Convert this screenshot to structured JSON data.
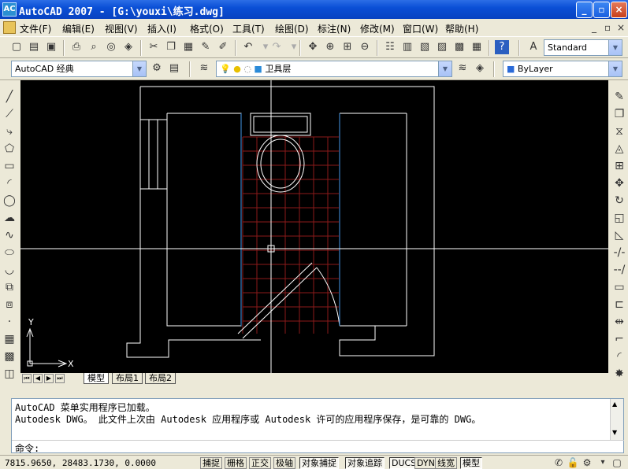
{
  "window": {
    "icon_text": "AC",
    "title": "AutoCAD 2007 - [G:\\youxi\\练习.dwg]",
    "minimize": "_",
    "maximize": "▫",
    "close": "×"
  },
  "menu": {
    "items": [
      "文件(F)",
      "编辑(E)",
      "视图(V)",
      "插入(I)",
      "格式(O)",
      "工具(T)",
      "绘图(D)",
      "标注(N)",
      "修改(M)",
      "窗口(W)",
      "帮助(H)"
    ],
    "mdi_min": "_",
    "mdi_restore": "▫",
    "mdi_close": "×"
  },
  "toolbar": {
    "text_style": "Standard",
    "workspace": "AutoCAD 经典",
    "layer": "卫具层",
    "color": "ByLayer"
  },
  "tabs": {
    "items": [
      "模型",
      "布局1",
      "布局2"
    ],
    "active": "模型"
  },
  "ucs": {
    "x_label": "X",
    "y_label": "Y"
  },
  "command": {
    "line1": "AutoCAD 菜单实用程序已加载。",
    "line2": "Autodesk DWG。  此文件上次由 Autodesk 应用程序或 Autodesk 许可的应用程序保存，是可靠的 DWG。",
    "prompt": "命令:"
  },
  "status": {
    "coordinates": "7815.9650,   28483.1730, 0.0000",
    "buttons": [
      "捕捉",
      "栅格",
      "正交",
      "极轴",
      "对象捕捉",
      "对象追踪",
      "DUCS",
      "DYN",
      "线宽",
      "模型"
    ],
    "on_buttons": [
      "对象捕捉",
      "对象追踪",
      "DUCS",
      "模型"
    ]
  },
  "colors": {
    "title_bar": "#0a4fd6",
    "canvas": "#000000",
    "lines": "#ffffff",
    "tile_grid": "#8b1a1a",
    "wall_edge": "#3a7fc0"
  }
}
